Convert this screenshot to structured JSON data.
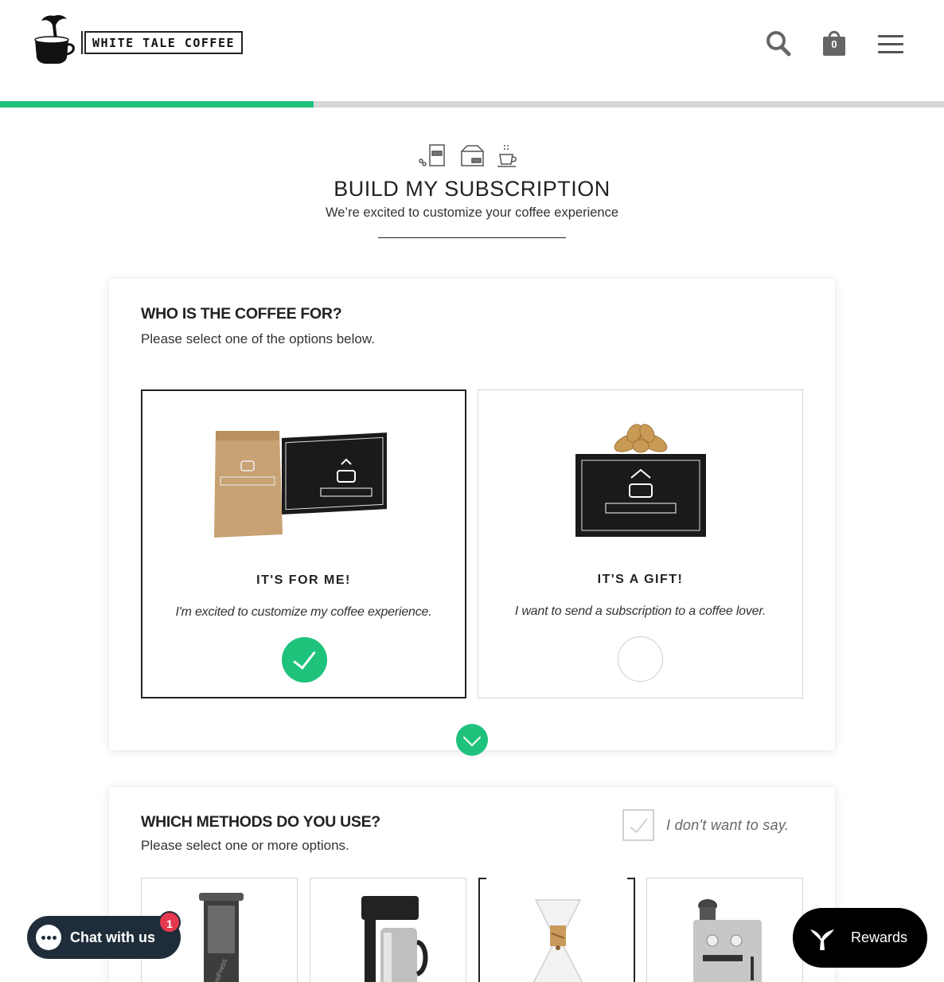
{
  "header": {
    "logo_text": "WHITE TALE COFFEE",
    "cart_count": "0",
    "search_icon": "search-icon",
    "cart_icon": "shopping-bag-icon",
    "menu_icon": "hamburger-menu-icon"
  },
  "progress": {
    "value": 0.332,
    "fill_color": "#1ec27a",
    "track_color": "#d6d6d6"
  },
  "intro": {
    "title": "BUILD MY SUBSCRIPTION",
    "subtitle": "We’re excited to customize your coffee experience"
  },
  "recipient_section": {
    "title": "WHO IS THE COFFEE FOR?",
    "subtitle": "Please select one of the options below.",
    "options": [
      {
        "title": "IT'S FOR ME!",
        "description": "I'm excited to customize my coffee experience.",
        "selected": true
      },
      {
        "title": "IT'S A GIFT!",
        "description": "I want to send a subscription to a coffee lover.",
        "selected": false
      }
    ]
  },
  "methods_section": {
    "title": "WHICH METHODS DO YOU USE?",
    "subtitle": "Please select one or more options.",
    "opt_out_label": "I don't want to say.",
    "methods": [
      {
        "icon": "aeropress-icon",
        "selected": false
      },
      {
        "icon": "drip-coffee-maker-icon",
        "selected": false
      },
      {
        "icon": "chemex-icon",
        "selected": true
      },
      {
        "icon": "espresso-machine-icon",
        "selected": false
      }
    ]
  },
  "chat": {
    "label": "Chat with us",
    "badge": "1"
  },
  "rewards": {
    "label": "Rewards"
  },
  "colors": {
    "accent": "#1ec27a",
    "chat_bg": "#1f2d3a",
    "badge": "#e6394f"
  }
}
